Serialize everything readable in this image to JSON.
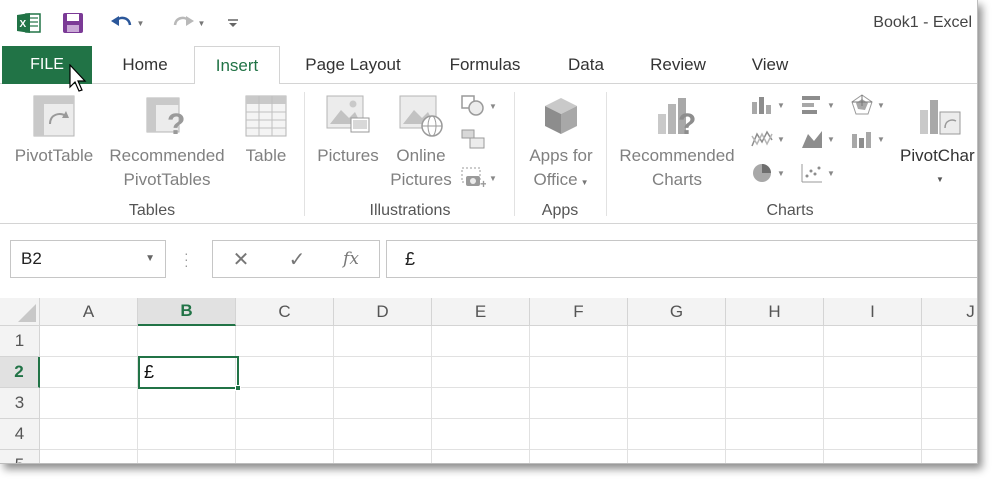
{
  "window": {
    "title": "Book1 - Excel"
  },
  "qat": {
    "app_icon": "excel-icon",
    "save_icon": "save-icon",
    "undo_icon": "undo-icon",
    "redo_icon": "redo-icon",
    "customize_icon": "customize-icon"
  },
  "tabs": [
    {
      "label": "FILE"
    },
    {
      "label": "Home"
    },
    {
      "label": "Insert"
    },
    {
      "label": "Page Layout"
    },
    {
      "label": "Formulas"
    },
    {
      "label": "Data"
    },
    {
      "label": "Review"
    },
    {
      "label": "View"
    }
  ],
  "active_tab": "Insert",
  "ribbon": {
    "groups": {
      "tables": {
        "label": "Tables",
        "pivottable": "PivotTable",
        "recommended_pivottables_1": "Recommended",
        "recommended_pivottables_2": "PivotTables",
        "table": "Table"
      },
      "illustrations": {
        "label": "Illustrations",
        "pictures": "Pictures",
        "online_pictures_1": "Online",
        "online_pictures_2": "Pictures"
      },
      "apps": {
        "label": "Apps",
        "apps_for_office_1": "Apps for",
        "apps_for_office_2": "Office"
      },
      "charts": {
        "label": "Charts",
        "recommended_charts_1": "Recommended",
        "recommended_charts_2": "Charts",
        "pivotchart": "PivotChar"
      }
    }
  },
  "formula_bar": {
    "name_box": "B2",
    "cancel": "✕",
    "enter": "✓",
    "function": "fx",
    "value": "£"
  },
  "grid": {
    "columns": [
      "A",
      "B",
      "C",
      "D",
      "E",
      "F",
      "G",
      "H",
      "I",
      "J"
    ],
    "rows": [
      "1",
      "2",
      "3",
      "4",
      "5"
    ],
    "active_cell": {
      "ref": "B2",
      "value": "£"
    }
  },
  "colors": {
    "accent": "#217346"
  }
}
